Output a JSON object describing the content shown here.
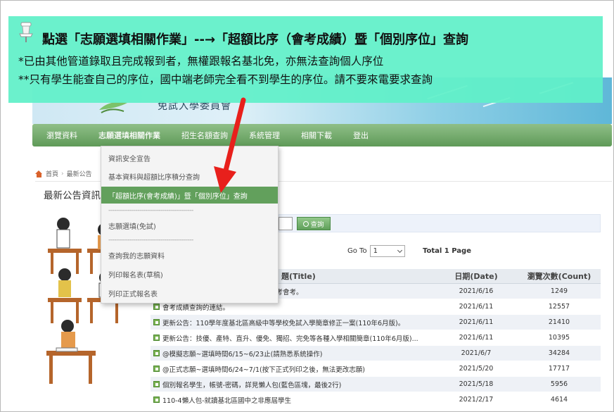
{
  "banner": {
    "text": "免試入學委員會"
  },
  "nav": {
    "items": [
      {
        "label": "瀏覽資料"
      },
      {
        "label": "志願選填相關作業"
      },
      {
        "label": "招生名額查詢"
      },
      {
        "label": "系統管理"
      },
      {
        "label": "相關下載"
      },
      {
        "label": "登出"
      }
    ]
  },
  "breadcrumb": {
    "home": "首頁",
    "current": "最新公告"
  },
  "section": {
    "title": "最新公告資訊"
  },
  "dropdown": {
    "items": [
      "資訊安全宣告",
      "基本資料與超額比序積分查詢",
      "「超額比序(會考成績)」暨「個別序位」查詢",
      "志願選填(免試)",
      "查詢我的志願資料",
      "列印報名表(草稿)",
      "列印正式報名表"
    ],
    "divider": "--------------------------------------------"
  },
  "search": {
    "button_label": "查詢"
  },
  "pager": {
    "goto_label": "Go To",
    "page_value": "1",
    "total_label": "Total 1 Page"
  },
  "table": {
    "headers": {
      "title": "題(Title)",
      "date": "日期(Date)",
      "count": "瀏覽次數(Count)"
    },
    "rows": [
      {
        "title": "考成績，若無成績則須追蹤該生是否有考會考。",
        "date": "2021/6/16",
        "count": "1249"
      },
      {
        "title": "會考成績查詢的連結。",
        "date": "2021/6/11",
        "count": "12557"
      },
      {
        "title": "更新公告：110學年度基北區高級中等學校免試入學簡章修正一案(110年6月版)。",
        "date": "2021/6/11",
        "count": "21410"
      },
      {
        "title": "更新公告：技優、產特、直升、優免、獨招、完免等各種入學相關簡章(110年6月版)...",
        "date": "2021/6/11",
        "count": "10395"
      },
      {
        "title": "@模擬志願~選填時間6/15~6/23止(請熟悉系統操作)",
        "date": "2021/6/7",
        "count": "34284"
      },
      {
        "title": "@正式志願~選填時間6/24~7/1(按下正式列印之後，無法更改志願)",
        "date": "2021/5/20",
        "count": "17717"
      },
      {
        "title": "個別報名學生，帳號-密碼，詳見懶人包(藍色區塊，最後2行)",
        "date": "2021/5/18",
        "count": "5956"
      },
      {
        "title": "110-4懶人包-就讀基北區國中之非應屆學生",
        "date": "2021/2/17",
        "count": "4614"
      }
    ]
  },
  "overlay": {
    "title": "點選「志願選填相關作業」--→「超額比序（會考成績）暨「個別序位」查詢",
    "line1": "*已由其他管道錄取且完成報到者，無權跟報名基北免，亦無法查詢個人序位",
    "line2": "**只有學生能查自己的序位，國中端老師完全看不到學生的序位。請不要來電要求查詢"
  },
  "colors": {
    "overlay": "#60f0c8",
    "nav_green": "#5f9a58",
    "arrow_red": "#e8201c"
  }
}
